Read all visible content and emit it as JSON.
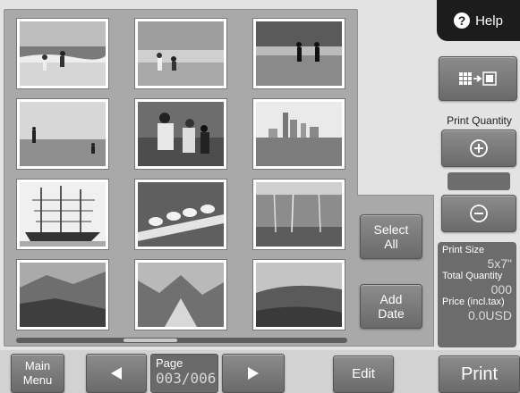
{
  "header": {
    "help_label": "Help",
    "help_icon": "question-circle-icon"
  },
  "thumbnails": [
    {
      "name": "beach-children-1"
    },
    {
      "name": "beach-children-2"
    },
    {
      "name": "beach-children-3"
    },
    {
      "name": "shore-figures"
    },
    {
      "name": "family-playing"
    },
    {
      "name": "city-skyline"
    },
    {
      "name": "tall-ship"
    },
    {
      "name": "seagulls-railing"
    },
    {
      "name": "bare-trees-pond"
    },
    {
      "name": "mountain-valley"
    },
    {
      "name": "rocky-mountains"
    },
    {
      "name": "hillside-slope"
    }
  ],
  "side": {
    "layout_toggle_icon": "grid-to-single-icon",
    "print_quantity_label": "Print Quantity",
    "increase_icon": "plus-icon",
    "decrease_icon": "minus-icon",
    "select_all_label": "Select All",
    "add_date_label": "Add Date"
  },
  "info": {
    "print_size_label": "Print Size",
    "print_size_value": "5x7\"",
    "total_quantity_label": "Total Quantity",
    "total_quantity_value": "000",
    "price_label": "Price (incl.tax)",
    "price_value": "0.0USD"
  },
  "bottom": {
    "main_menu_label": "Main Menu",
    "prev_icon": "triangle-left-icon",
    "page_label": "Page",
    "page_value": "003/006",
    "next_icon": "triangle-right-icon",
    "edit_label": "Edit",
    "print_label": "Print"
  }
}
